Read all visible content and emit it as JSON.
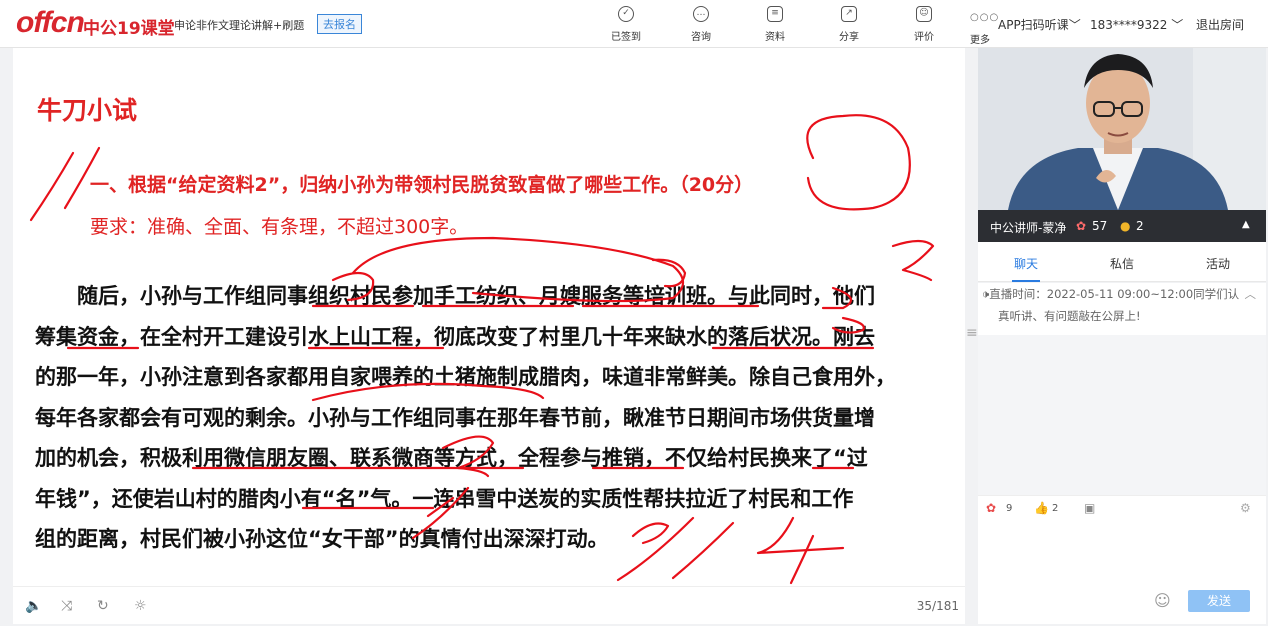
{
  "header": {
    "logo_text": "offcn",
    "brand": "中公19课堂",
    "course_title": "申论非作文理论讲解+刷题",
    "signup_label": "去报名",
    "tools": [
      {
        "icon": "checkin-icon",
        "label": "已签到"
      },
      {
        "icon": "consult-icon",
        "label": "咨询"
      },
      {
        "icon": "materials-icon",
        "label": "资料"
      },
      {
        "icon": "share-icon",
        "label": "分享"
      },
      {
        "icon": "rating-icon",
        "label": "评价"
      }
    ],
    "more_label": "更多",
    "app_scan": "APP扫码听课",
    "user_phone": "183****9322",
    "exit_label": "退出房间"
  },
  "slide": {
    "title": "牛刀小试",
    "question": "一、根据“给定资料2”，归纳小孙为带领村民脱贫致富做了哪些工作。（20分）",
    "requirement": "要求：准确、全面、有条理，不超过300字。",
    "lines": [
      "　　随后，小孙与工作组同事组织村民参加手工纺织、月嫂服务等培训班。与此同时，他们",
      "筹集资金，在全村开工建设引水上山工程，彻底改变了村里几十年来缺水的落后状况。刚去",
      "的那一年，小孙注意到各家都用自家喂养的土猪施制成腊肉，味道非常鲜美。除自己食用外，",
      "每年各家都会有可观的剩余。小孙与工作组同事在那年春节前，瞅准节日期间市场供货量增",
      "加的机会，积极利用微信朋友圈、联系微商等方式，全程参与推销，不仅给村民换来了“过",
      "年钱”，还使岩山村的腊肉小有“名”气。一连串雪中送炭的实质性帮扶拉近了村民和工作",
      "组的距离，村民们被小孙这位“女干部”的真情付出深深打动。"
    ]
  },
  "player": {
    "page": "35/181"
  },
  "live": {
    "teacher": "中公讲师-蒙净",
    "flowers": "57",
    "coins": "2"
  },
  "chat": {
    "tabs": [
      "聊天",
      "私信",
      "活动"
    ],
    "notice": "直播时间：2022-05-11 09:00~12:00同学们认真听讲、有问题敲在公屏上！",
    "notice_line1": "直播时间：2022-05-11 09:00~12:00同学们认",
    "notice_line2": "真听讲、有问题敲在公屏上!",
    "flower_count": "9",
    "like_count": "2",
    "send_label": "发送"
  }
}
